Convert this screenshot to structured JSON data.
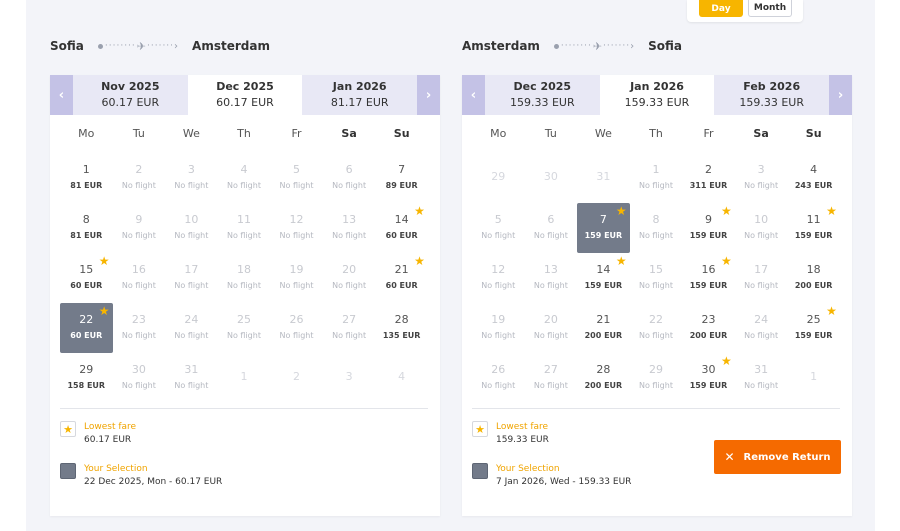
{
  "toggle": {
    "day": "Day",
    "month": "Month"
  },
  "outbound": {
    "from": "Sofia",
    "to": "Amsterdam",
    "months": [
      {
        "name": "Nov 2025",
        "price": "60.17 EUR"
      },
      {
        "name": "Dec 2025",
        "price": "60.17 EUR"
      },
      {
        "name": "Jan 2026",
        "price": "81.17 EUR"
      }
    ],
    "weekdays": [
      "Mo",
      "Tu",
      "We",
      "Th",
      "Fr",
      "Sa",
      "Su"
    ],
    "weeks": [
      [
        [
          "1",
          "81 EUR"
        ],
        [
          "2",
          "No flight"
        ],
        [
          "3",
          "No flight"
        ],
        [
          "4",
          "No flight"
        ],
        [
          "5",
          "No flight"
        ],
        [
          "6",
          "No flight"
        ],
        [
          "7",
          "89 EUR"
        ]
      ],
      [
        [
          "8",
          "81 EUR"
        ],
        [
          "9",
          "No flight"
        ],
        [
          "10",
          "No flight"
        ],
        [
          "11",
          "No flight"
        ],
        [
          "12",
          "No flight"
        ],
        [
          "13",
          "No flight"
        ],
        [
          "14",
          "60 EUR"
        ]
      ],
      [
        [
          "15",
          "60 EUR"
        ],
        [
          "16",
          "No flight"
        ],
        [
          "17",
          "No flight"
        ],
        [
          "18",
          "No flight"
        ],
        [
          "19",
          "No flight"
        ],
        [
          "20",
          "No flight"
        ],
        [
          "21",
          "60 EUR"
        ]
      ],
      [
        [
          "22",
          "60 EUR"
        ],
        [
          "23",
          "No flight"
        ],
        [
          "24",
          "No flight"
        ],
        [
          "25",
          "No flight"
        ],
        [
          "26",
          "No flight"
        ],
        [
          "27",
          "No flight"
        ],
        [
          "28",
          "135 EUR"
        ]
      ],
      [
        [
          "29",
          "158 EUR"
        ],
        [
          "30",
          "No flight"
        ],
        [
          "31",
          "No flight"
        ],
        [
          "1",
          ""
        ],
        [
          "2",
          ""
        ],
        [
          "3",
          ""
        ],
        [
          "4",
          ""
        ]
      ]
    ],
    "lowest_label": "Lowest fare",
    "lowest_value": "60.17 EUR",
    "selection_label": "Your Selection",
    "selection_value": "22 Dec 2025, Mon - 60.17 EUR"
  },
  "return": {
    "from": "Amsterdam",
    "to": "Sofia",
    "months": [
      {
        "name": "Dec 2025",
        "price": "159.33 EUR"
      },
      {
        "name": "Jan 2026",
        "price": "159.33 EUR"
      },
      {
        "name": "Feb 2026",
        "price": "159.33 EUR"
      }
    ],
    "weekdays": [
      "Mo",
      "Tu",
      "We",
      "Th",
      "Fr",
      "Sa",
      "Su"
    ],
    "weeks": [
      [
        [
          "29",
          ""
        ],
        [
          "30",
          ""
        ],
        [
          "31",
          ""
        ],
        [
          "1",
          "No flight"
        ],
        [
          "2",
          "311 EUR"
        ],
        [
          "3",
          "No flight"
        ],
        [
          "4",
          "243 EUR"
        ]
      ],
      [
        [
          "5",
          "No flight"
        ],
        [
          "6",
          "No flight"
        ],
        [
          "7",
          "159 EUR"
        ],
        [
          "8",
          "No flight"
        ],
        [
          "9",
          "159 EUR"
        ],
        [
          "10",
          "No flight"
        ],
        [
          "11",
          "159 EUR"
        ]
      ],
      [
        [
          "12",
          "No flight"
        ],
        [
          "13",
          "No flight"
        ],
        [
          "14",
          "159 EUR"
        ],
        [
          "15",
          "No flight"
        ],
        [
          "16",
          "159 EUR"
        ],
        [
          "17",
          "No flight"
        ],
        [
          "18",
          "200 EUR"
        ]
      ],
      [
        [
          "19",
          "No flight"
        ],
        [
          "20",
          "No flight"
        ],
        [
          "21",
          "200 EUR"
        ],
        [
          "22",
          "No flight"
        ],
        [
          "23",
          "200 EUR"
        ],
        [
          "24",
          "No flight"
        ],
        [
          "25",
          "159 EUR"
        ]
      ],
      [
        [
          "26",
          "No flight"
        ],
        [
          "27",
          "No flight"
        ],
        [
          "28",
          "200 EUR"
        ],
        [
          "29",
          "No flight"
        ],
        [
          "30",
          "159 EUR"
        ],
        [
          "31",
          "No flight"
        ],
        [
          "1",
          ""
        ]
      ]
    ],
    "lowest_label": "Lowest fare",
    "lowest_value": "159.33 EUR",
    "selection_label": "Your Selection",
    "selection_value": "7 Jan 2026, Wed - 159.33 EUR",
    "remove_label": "Remove Return"
  },
  "colors": {
    "accent": "#f7b500",
    "selected": "#737b8a",
    "remove": "#f56a00",
    "nav": "#c4c2e6"
  }
}
